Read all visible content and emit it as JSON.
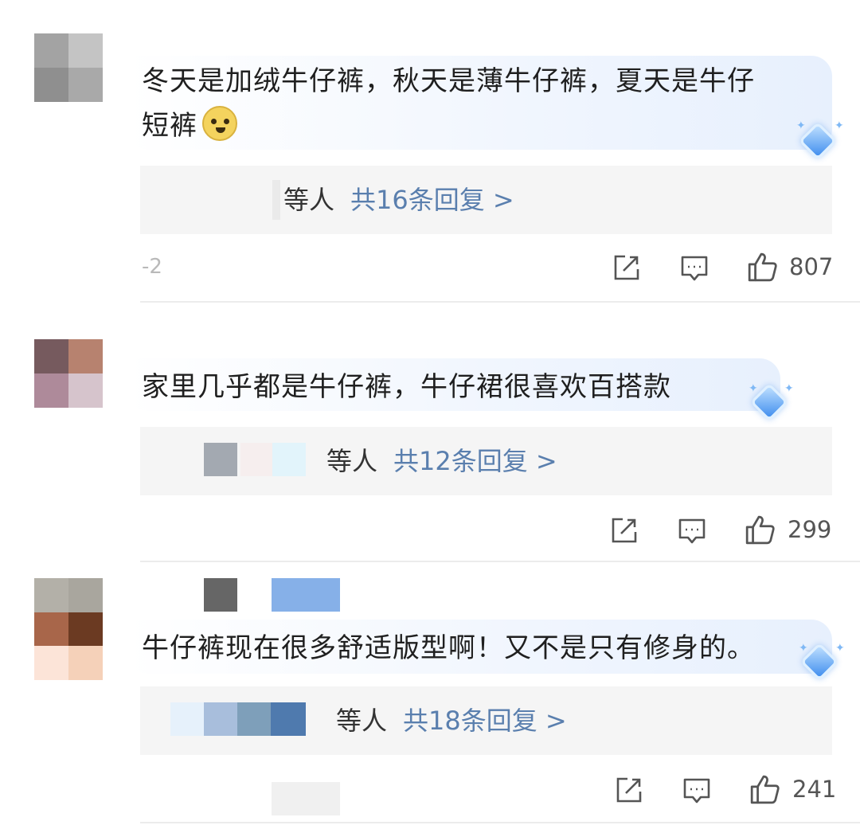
{
  "comments": [
    {
      "text": "冬天是加绒牛仔裤，秋天是薄牛仔裤，夏天是牛仔短裤",
      "line1": "冬天是加绒牛仔裤，秋天是薄牛仔裤，夏天是牛仔",
      "line2": "短裤",
      "emoji": "doge-emoji",
      "reply_suffix": "等人",
      "reply_count_label": "共16条回复 >",
      "date": "-2",
      "likes": "807"
    },
    {
      "text": "家里几乎都是牛仔裤，牛仔裙很喜欢百搭款",
      "reply_suffix": "等人",
      "reply_count_label": "共12条回复 >",
      "date": "",
      "likes": "299"
    },
    {
      "text": "牛仔裤现在很多舒适版型啊！又不是只有修身的。",
      "reply_suffix": "等人",
      "reply_count_label": "共18条回复 >",
      "date": "",
      "likes": "241"
    }
  ],
  "icons": {
    "share": "share-icon",
    "comment": "comment-icon",
    "like": "thumbs-up-icon",
    "badge": "diamond-badge-icon"
  },
  "colors": {
    "reply_link": "#5a7fae",
    "reply_box_bg": "#f5f5f5",
    "bubble_accent": "#e7f0fd"
  }
}
